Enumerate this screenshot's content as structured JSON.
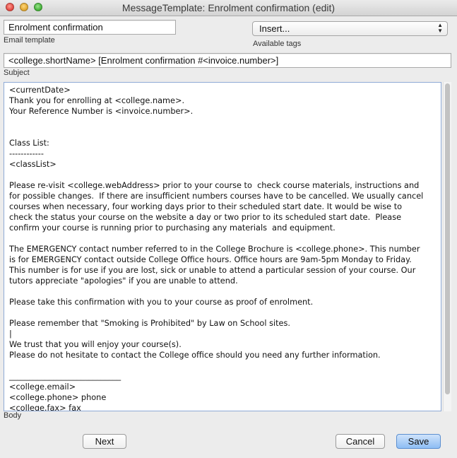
{
  "window": {
    "title": "MessageTemplate: Enrolment confirmation (edit)"
  },
  "template_name": {
    "value": "Enrolment confirmation",
    "caption": "Email template"
  },
  "tags": {
    "selected": "Insert...",
    "caption": "Available tags"
  },
  "subject": {
    "value": "<college.shortName> [Enrolment confirmation #<invoice.number>]",
    "caption": "Subject"
  },
  "body": {
    "lines": [
      "<currentDate>",
      "Thank you for enrolling at <college.name>.",
      "Your Reference Number is <invoice.number>.",
      "",
      "",
      "Class List:",
      "------------",
      "<classList>",
      "",
      "Please re-visit <college.webAddress> prior to your course to  check course materials, instructions and",
      "for possible changes.  If there are insufficient numbers courses have to be cancelled. We usually cancel",
      "courses when necessary, four working days prior to their scheduled start date. It would be wise to",
      "check the status your course on the website a day or two prior to its scheduled start date.  Please",
      "confirm your course is running prior to purchasing any materials  and equipment.",
      "",
      "The EMERGENCY contact number referred to in the College Brochure is <college.phone>. This number",
      "is for EMERGENCY contact outside College Office hours. Office hours are 9am-5pm Monday to Friday.",
      "This number is for use if you are lost, sick or unable to attend a particular session of your course. Our",
      "tutors appreciate \"apologies\" if you are unable to attend.",
      "",
      "Please take this confirmation with you to your course as proof of enrolment.",
      "",
      "Please remember that \"Smoking is Prohibited\" by Law on School sites.",
      "|",
      "We trust that you will enjoy your course(s).",
      "Please do not hesitate to contact the College office should you need any further information.",
      "",
      "____________________________",
      "<college.email>",
      "<college.phone> phone",
      "<college.fax> fax"
    ],
    "caption": "Body"
  },
  "buttons": {
    "next": "Next",
    "cancel": "Cancel",
    "save": "Save"
  }
}
